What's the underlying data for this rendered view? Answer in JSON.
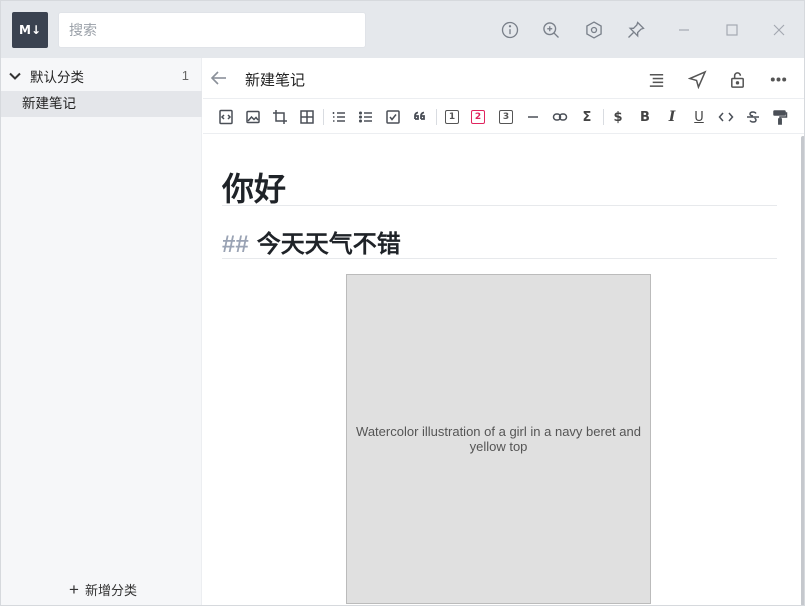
{
  "app": {
    "logo_text": "M↓",
    "search_placeholder": "搜索"
  },
  "sidebar": {
    "category_label": "默认分类",
    "category_count": "1",
    "notes": [
      {
        "label": "新建笔记",
        "selected": true
      }
    ],
    "add_category_label": "新增分类"
  },
  "document": {
    "title": "新建笔记",
    "heading1": "你好",
    "heading2_marker": "##",
    "heading2_text": "今天天气不错"
  },
  "toolbar": {
    "h1_label": "1",
    "h2_label": "2",
    "h3_label": "3",
    "dollar_label": "$",
    "bold_label": "B",
    "italic_label": "I",
    "underline_label": "U",
    "sigma_label": "Σ"
  },
  "colors": {
    "titlebar_bg": "#e5e8ec",
    "logo_bg": "#3a4250",
    "active_heading": "#e0245e",
    "sidebar_bg": "#f6f7f9",
    "selected_note_bg": "#e4e6ea"
  }
}
